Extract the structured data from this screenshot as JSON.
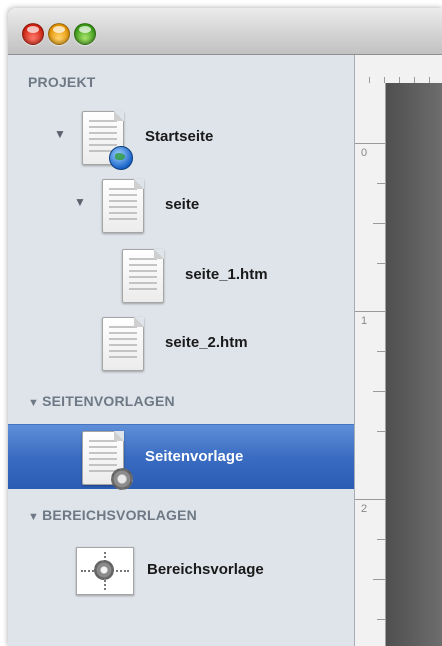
{
  "window": {
    "controls": [
      {
        "name": "close",
        "color": "#e0301e"
      },
      {
        "name": "minimize",
        "color": "#f0a21a"
      },
      {
        "name": "zoom",
        "color": "#5cb92a"
      }
    ]
  },
  "sidebar": {
    "sections": [
      {
        "label": "PROJEKT"
      },
      {
        "label": "SEITENVORLAGEN"
      },
      {
        "label": "BEREICHSVORLAGEN"
      }
    ],
    "items": [
      {
        "label": "Startseite",
        "icon": "page-globe-icon"
      },
      {
        "label": "seite",
        "icon": "page-icon"
      },
      {
        "label": "seite_1.htm",
        "icon": "page-icon"
      },
      {
        "label": "seite_2.htm",
        "icon": "page-icon"
      },
      {
        "label": "Seitenvorlage",
        "icon": "page-gear-icon",
        "selected": true
      },
      {
        "label": "Bereichsvorlage",
        "icon": "area-gear-icon"
      }
    ],
    "selection_color": "#3a6cc2"
  },
  "ruler": {
    "marks": [
      "0",
      "1",
      "2"
    ]
  }
}
